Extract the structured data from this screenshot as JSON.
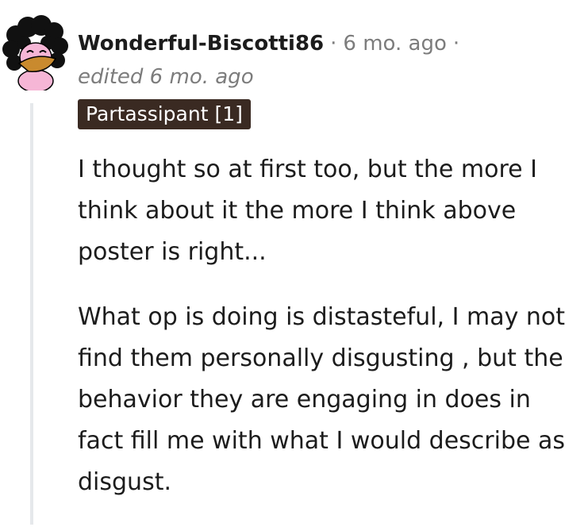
{
  "comment": {
    "author": "Wonderful-Biscotti86",
    "separator": "·",
    "time": "6 mo. ago",
    "trailing_separator": "·",
    "edited": "edited 6 mo. ago",
    "flair": "Partassipant [1]",
    "paragraphs": [
      "I thought so at first too, but the more I think about it the more I think above poster is right...",
      "What op is doing is distasteful, I may not find them personally disgusting , but the behavior they are engaging in does in fact fill me with what I would describe as disgust."
    ]
  },
  "colors": {
    "flair_bg": "#3a2a22",
    "meta_gray": "#7c7c7c",
    "thread_line": "#e5e8eb",
    "avatar_pink": "#f6b6d6"
  },
  "icons": {
    "avatar": "user-avatar-icon"
  }
}
